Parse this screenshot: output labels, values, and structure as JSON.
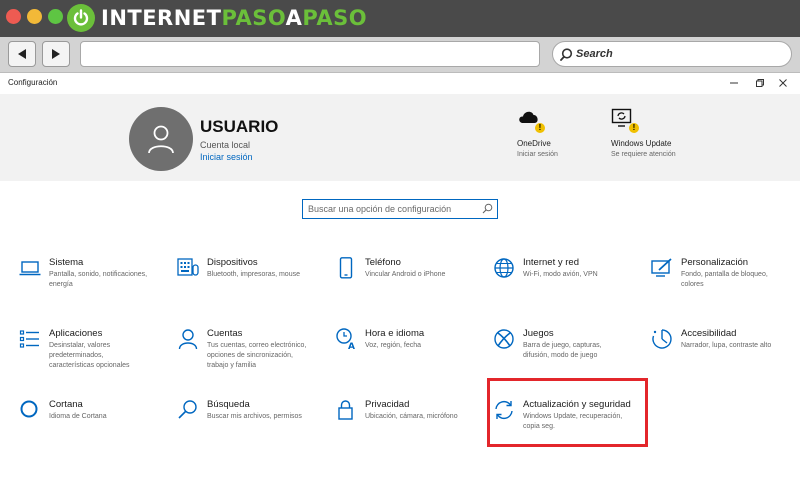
{
  "browser": {
    "logo_part1": "INTERNET",
    "logo_part2": "PASO",
    "logo_part3": "A",
    "logo_part4": "PASO",
    "search_label": "Search",
    "colors": {
      "logo_green": "#6bbf3a"
    }
  },
  "window": {
    "title": "Configuración"
  },
  "user": {
    "name": "USUARIO",
    "account_type": "Cuenta local",
    "signin_link": "Iniciar sesión"
  },
  "header_items": [
    {
      "icon": "onedrive-icon",
      "title": "OneDrive",
      "subtitle": "Iniciar sesión"
    },
    {
      "icon": "windows-update-icon",
      "title": "Windows Update",
      "subtitle": "Se requiere atención"
    }
  ],
  "search": {
    "placeholder": "Buscar una opción de configuración"
  },
  "categories": [
    {
      "id": "sistema",
      "icon": "laptop-icon",
      "title": "Sistema",
      "desc_lines": [
        "Pantalla, sonido, notificaciones,",
        "energía"
      ]
    },
    {
      "id": "dispositivos",
      "icon": "keyboard-icon",
      "title": "Dispositivos",
      "desc_lines": [
        "Bluetooth, impresoras, mouse"
      ]
    },
    {
      "id": "telefono",
      "icon": "phone-icon",
      "title": "Teléfono",
      "desc_lines": [
        "Vincular Android o iPhone"
      ]
    },
    {
      "id": "internet",
      "icon": "globe-icon",
      "title": "Internet y red",
      "desc_lines": [
        "Wi-Fi, modo avión, VPN"
      ]
    },
    {
      "id": "personalizacion",
      "icon": "paint-icon",
      "title": "Personalización",
      "desc_lines": [
        "Fondo, pantalla de bloqueo,",
        "colores"
      ]
    },
    {
      "id": "aplicaciones",
      "icon": "apps-list-icon",
      "title": "Aplicaciones",
      "desc_lines": [
        "Desinstalar, valores",
        "predeterminados,",
        "características opcionales"
      ]
    },
    {
      "id": "cuentas",
      "icon": "person-icon",
      "title": "Cuentas",
      "desc_lines": [
        "Tus cuentas, correo electrónico,",
        "opciones de sincronización,",
        "trabajo y familia"
      ]
    },
    {
      "id": "hora",
      "icon": "clock-language-icon",
      "title": "Hora e idioma",
      "desc_lines": [
        "Voz, región, fecha"
      ]
    },
    {
      "id": "juegos",
      "icon": "xbox-icon",
      "title": "Juegos",
      "desc_lines": [
        "Barra de juego, capturas,",
        "difusión, modo de juego"
      ]
    },
    {
      "id": "accesibilidad",
      "icon": "accessibility-icon",
      "title": "Accesibilidad",
      "desc_lines": [
        "Narrador, lupa, contraste alto"
      ]
    },
    {
      "id": "cortana",
      "icon": "cortana-icon",
      "title": "Cortana",
      "desc_lines": [
        "Idioma de Cortana"
      ]
    },
    {
      "id": "busqueda",
      "icon": "search-icon",
      "title": "Búsqueda",
      "desc_lines": [
        "Buscar mis archivos, permisos"
      ]
    },
    {
      "id": "privacidad",
      "icon": "lock-icon",
      "title": "Privacidad",
      "desc_lines": [
        "Ubicación, cámara, micrófono"
      ]
    },
    {
      "id": "actualizacion",
      "icon": "sync-icon",
      "title": "Actualización y seguridad",
      "desc_lines": [
        "Windows Update, recuperación,",
        "copia seg."
      ]
    }
  ],
  "colors": {
    "accent": "#0067c0",
    "highlight": "#e3262b",
    "header_bg": "#f2f2f2"
  }
}
